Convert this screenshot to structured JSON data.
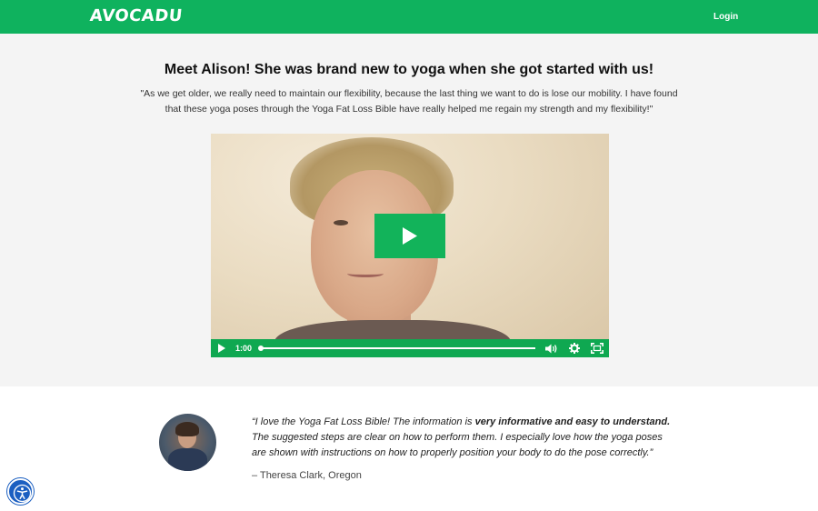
{
  "header": {
    "logo": "AVOCADU",
    "login_label": "Login",
    "brand_color": "#0fb25e"
  },
  "hero": {
    "headline": "Meet Alison! She was brand new to yoga when she got started with us!",
    "quote": "\"As we get older, we really need to maintain our flexibility, because the last thing we want to do is lose our mobility. I have found that these yoga poses through the Yoga Fat Loss Bible have really helped me regain my strength and my flexibility!\""
  },
  "video": {
    "time": "1:00",
    "progress_fraction": 0.0,
    "icons": [
      "play-icon",
      "volume-icon",
      "gear-icon",
      "fullscreen-icon"
    ]
  },
  "testimonial": {
    "quote_before": "“I love the Yoga Fat Loss Bible! The information is ",
    "quote_bold": "very informative and easy to understand.",
    "quote_after": " The suggested steps are clear on how to perform them. I especially love how the yoga poses are shown with instructions on how to properly position your body to do the pose correctly.”",
    "author": "– Theresa Clark, Oregon"
  },
  "accessibility": {
    "icon": "accessibility-icon"
  }
}
